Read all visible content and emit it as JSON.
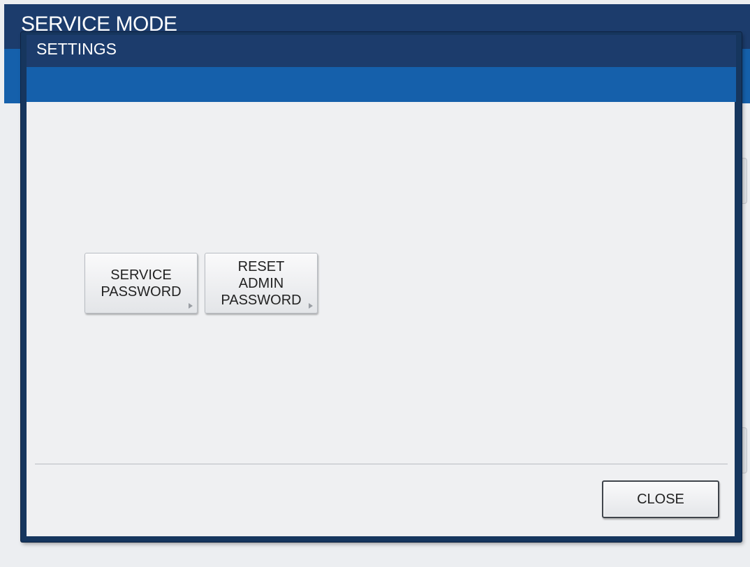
{
  "background_app": {
    "title": "SERVICE MODE"
  },
  "dialog": {
    "title": "SETTINGS",
    "buttons": [
      {
        "label": "SERVICE\nPASSWORD",
        "icon": "arrow-right-icon"
      },
      {
        "label": "RESET\nADMIN\nPASSWORD",
        "icon": "arrow-right-icon"
      }
    ],
    "close_label": "CLOSE"
  },
  "colors": {
    "title_bar": "#1c3c6c",
    "accent_band": "#1560ab",
    "body": "#eff0f2"
  }
}
